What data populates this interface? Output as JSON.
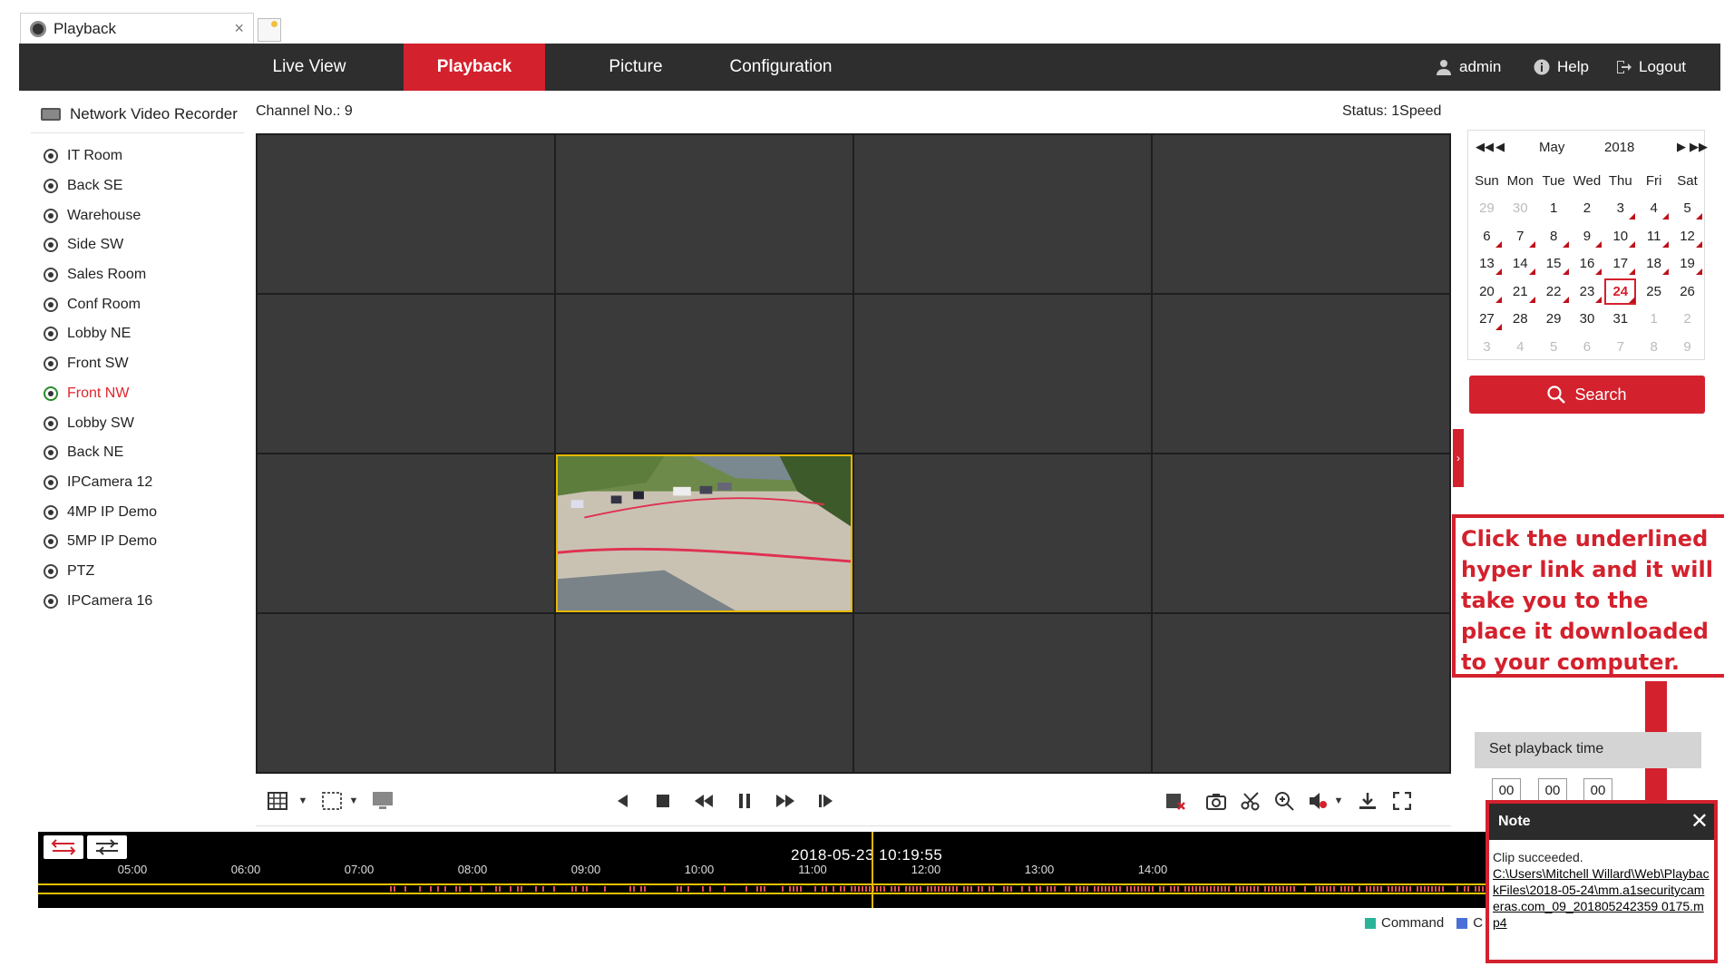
{
  "browser_tab": {
    "title": "Playback",
    "close": "×"
  },
  "nav": {
    "tabs": [
      {
        "label": "Live View"
      },
      {
        "label": "Playback",
        "active": true
      },
      {
        "label": "Picture"
      },
      {
        "label": "Configuration"
      }
    ],
    "user": "admin",
    "help": "Help",
    "logout": "Logout"
  },
  "tree": {
    "root": "Network Video Recorder",
    "cameras": [
      "IT Room",
      "Back SE",
      "Warehouse",
      "Side SW",
      "Sales Room",
      "Conf Room",
      "Lobby NE",
      "Front SW",
      "Front NW",
      "Lobby SW",
      "Back NE",
      "IPCamera 12",
      "4MP IP Demo",
      "5MP IP Demo",
      "PTZ",
      "IPCamera 16"
    ],
    "active": "Front NW"
  },
  "channel": "Channel No.: 9",
  "status": "Status: 1Speed",
  "timeline": {
    "datetime": "2018-05-23 10:19:55",
    "ticks": [
      "05:00",
      "06:00",
      "07:00",
      "08:00",
      "09:00",
      "10:00",
      "11:00",
      "12:00",
      "13:00",
      "14:00"
    ]
  },
  "legend": {
    "command": "Command",
    "truncated": "C"
  },
  "colors": {
    "accent": "#d3212d",
    "command": "#2bb39a",
    "other": "#4a6fd8",
    "timeline_bg": "#000000",
    "recording": "#e05050"
  },
  "calendar": {
    "month": "May",
    "year": "2018",
    "weekdays": [
      "Sun",
      "Mon",
      "Tue",
      "Wed",
      "Thu",
      "Fri",
      "Sat"
    ],
    "weeks": [
      [
        "29",
        "30",
        "1",
        "2",
        "3",
        "4",
        "5"
      ],
      [
        "6",
        "7",
        "8",
        "9",
        "10",
        "11",
        "12"
      ],
      [
        "13",
        "14",
        "15",
        "16",
        "17",
        "18",
        "19"
      ],
      [
        "20",
        "21",
        "22",
        "23",
        "24",
        "25",
        "26"
      ],
      [
        "27",
        "28",
        "29",
        "30",
        "31",
        "1",
        "2"
      ],
      [
        "3",
        "4",
        "5",
        "6",
        "7",
        "8",
        "9"
      ]
    ],
    "today": "24"
  },
  "search_label": "Search",
  "annotation": "Click the underlined hyper link and it will take you to the place it downloaded to your computer.",
  "playback_time": {
    "label": "Set playback time",
    "hh": "00",
    "mm": "00",
    "ss": "00"
  },
  "note": {
    "title": "Note",
    "message": "Clip succeeded.",
    "link": "C:\\Users\\Mitchell Willard\\Web\\PlaybackFiles\\2018-05-24\\mm.a1securitycameras.com_09_201805242359 0175.mp4"
  }
}
